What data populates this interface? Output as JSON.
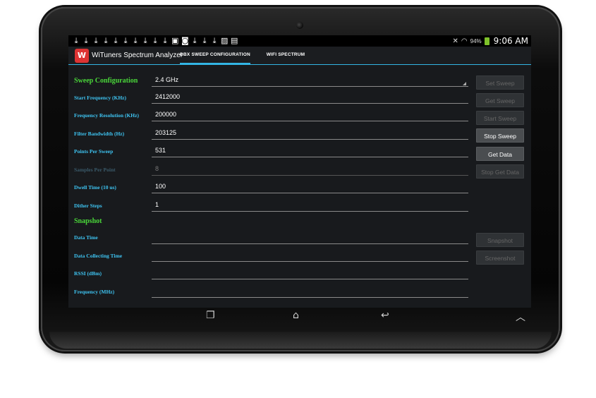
{
  "status_bar": {
    "notification_icons": [
      "download-icon",
      "download-icon",
      "download-icon",
      "download-icon",
      "download-icon",
      "download-icon",
      "download-icon",
      "download-icon",
      "download-icon",
      "download-icon",
      "sd-card-icon",
      "camera-icon",
      "download-icon",
      "download-icon",
      "download-icon",
      "image-icon",
      "briefcase-icon"
    ],
    "battery_percent": "94%",
    "time": "9:06 AM"
  },
  "app": {
    "title": "WiTuners Spectrum Analyzer",
    "icon": "witunes-logo-icon",
    "tabs": [
      {
        "label": "DBX SWEEP CONFIGURATION",
        "active": true
      },
      {
        "label": "WIFI SPECTRUM",
        "active": false
      }
    ]
  },
  "sweep": {
    "section_title": "Sweep Configuration",
    "band": "2.4 GHz",
    "fields": [
      {
        "label": "Start Frequency (KHz)",
        "value": "2412000",
        "disabled": false
      },
      {
        "label": "Frequency Resolution (KHz)",
        "value": "200000",
        "disabled": false
      },
      {
        "label": "Filter Bandwidth (Hz)",
        "value": "203125",
        "disabled": false
      },
      {
        "label": "Points Per Sweep",
        "value": "531",
        "disabled": false
      },
      {
        "label": "Samples Per Point",
        "value": "8",
        "disabled": true
      },
      {
        "label": "Dwell Time (10 us)",
        "value": "100",
        "disabled": false
      },
      {
        "label": "Dither Steps",
        "value": "1",
        "disabled": false
      }
    ]
  },
  "snapshot": {
    "section_title": "Snapshot",
    "fields": [
      {
        "label": "Data Time",
        "value": ""
      },
      {
        "label": "Data Collecting Time",
        "value": ""
      },
      {
        "label": "RSSI (dBm)",
        "value": ""
      },
      {
        "label": "Frequency (MHz)",
        "value": ""
      }
    ]
  },
  "buttons": {
    "set_sweep": "Set Sweep",
    "get_sweep": "Get Sweep",
    "start_sweep": "Start Sweep",
    "stop_sweep": "Stop Sweep",
    "get_data": "Get Data",
    "stop_get_data": "Stop Get Data",
    "snapshot": "Snapshot",
    "screenshot": "Screenshot"
  },
  "colors": {
    "accent": "#33b5e5",
    "section_title": "#4ad83a",
    "label": "#3ec4f2"
  }
}
